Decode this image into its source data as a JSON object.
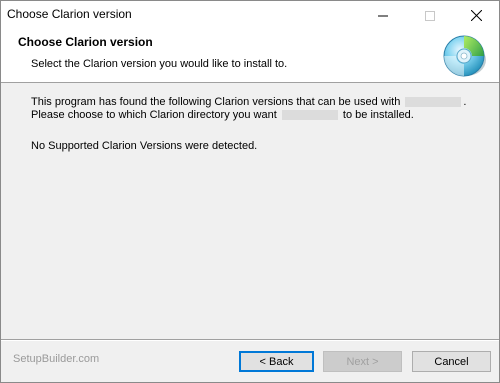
{
  "window": {
    "title": "Choose Clarion version"
  },
  "header": {
    "title": "Choose Clarion version",
    "subtitle": "Select the Clarion version you would like to install to.",
    "icon": "cd-disc-icon"
  },
  "content": {
    "line1": "This program has found the following Clarion versions that can be used with",
    "line1_end": ".",
    "line2_start": "Please choose to which Clarion directory you want",
    "line2_end": "to be installed.",
    "status": "No Supported Clarion Versions were detected."
  },
  "footer": {
    "brand": "SetupBuilder.com",
    "back_label": "< Back",
    "next_label": "Next >",
    "cancel_label": "Cancel"
  },
  "colors": {
    "accent": "#0078d7",
    "disabled_text": "#a0a0a0",
    "redaction": "#dcdcdc"
  }
}
